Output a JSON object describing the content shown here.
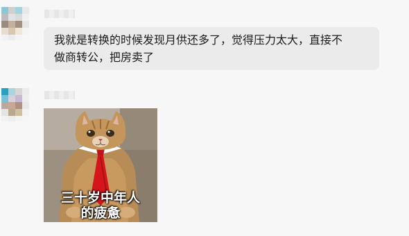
{
  "messages": [
    {
      "type": "text",
      "lines": [
        "我就是转换的时候发现月供还多了，觉得压力太大，直接不",
        "做商转公，把房卖了"
      ]
    },
    {
      "type": "sticker",
      "icon": "cat-in-suit-sticker",
      "caption_lines": [
        "三十岁中年人",
        "的疲惫"
      ]
    }
  ],
  "colors": {
    "background": "#f7f7f8",
    "bubble": "#ebebec",
    "text": "#1a1a1a"
  }
}
